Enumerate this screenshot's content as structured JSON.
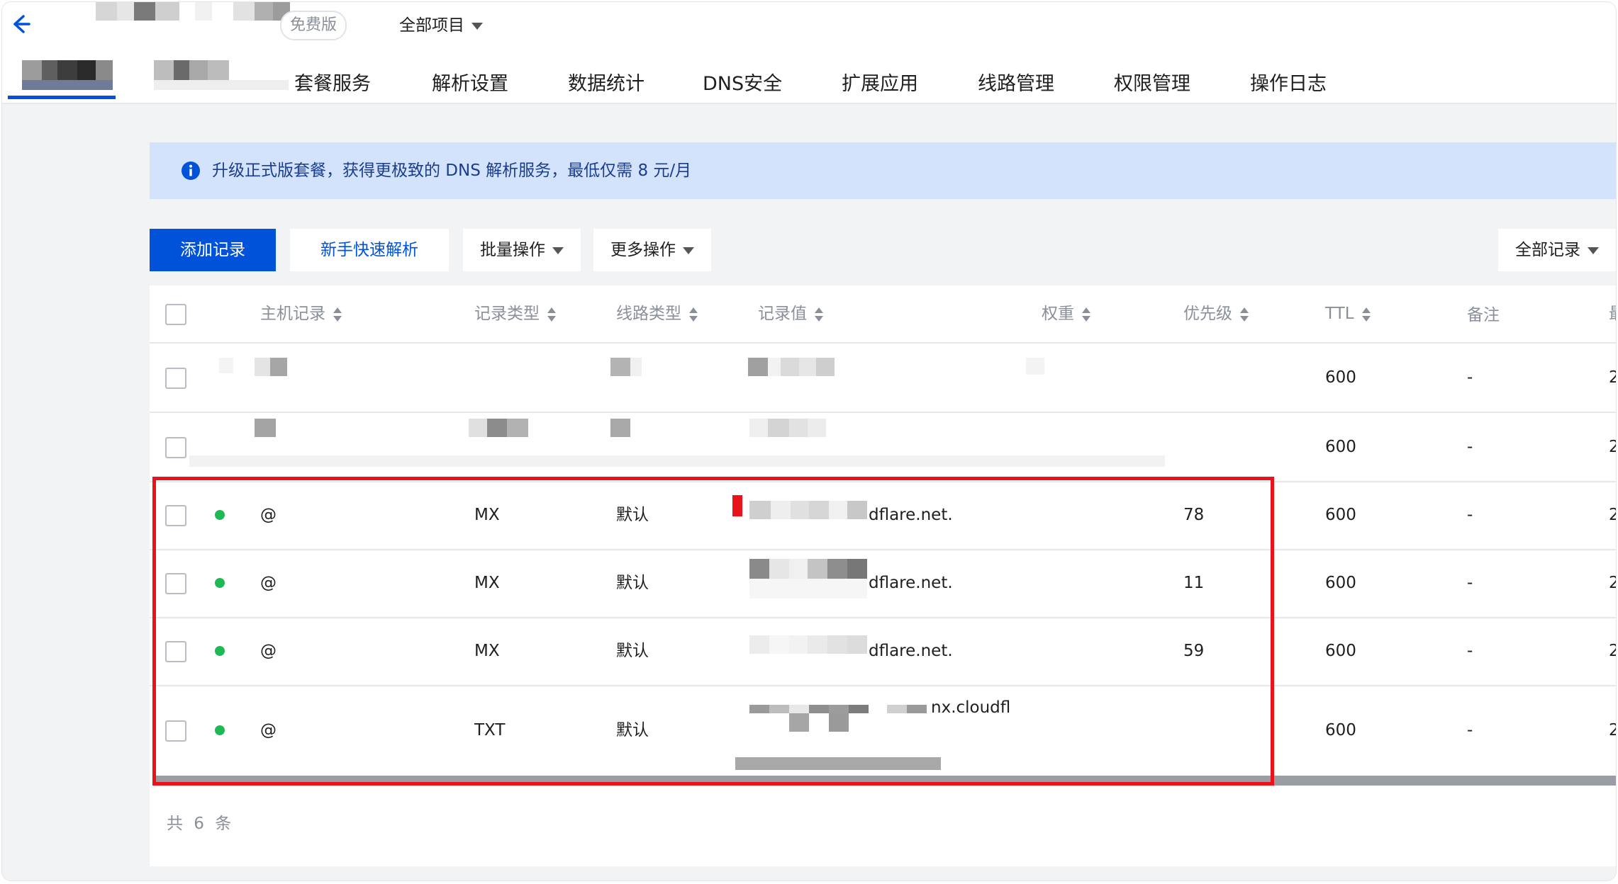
{
  "header": {
    "back_icon": "arrow-left-icon",
    "plan_badge": "免费版",
    "project_select": "全部项目"
  },
  "tabs": [
    {
      "label": "套餐服务"
    },
    {
      "label": "解析设置"
    },
    {
      "label": "数据统计"
    },
    {
      "label": "DNS安全"
    },
    {
      "label": "扩展应用"
    },
    {
      "label": "线路管理"
    },
    {
      "label": "权限管理"
    },
    {
      "label": "操作日志"
    }
  ],
  "notice": {
    "icon": "info-icon",
    "text": "升级正式版套餐，获得更极致的 DNS 解析服务，最低仅需 8 元/月"
  },
  "toolbar": {
    "add_record": "添加记录",
    "quick_parse": "新手快速解析",
    "batch_ops": "批量操作",
    "more_ops": "更多操作",
    "record_filter": "全部记录"
  },
  "table": {
    "headers": {
      "host": "主机记录",
      "type": "记录类型",
      "line": "线路类型",
      "value": "记录值",
      "weight": "权重",
      "priority": "优先级",
      "ttl": "TTL",
      "remark": "备注",
      "last": "最"
    },
    "rows": [
      {
        "host": "",
        "type": "",
        "line": "",
        "value": "",
        "priority": "",
        "ttl": "600",
        "remark": "-",
        "last": "2"
      },
      {
        "host": "",
        "type": "",
        "line": "",
        "value": "",
        "priority": "",
        "ttl": "600",
        "remark": "-",
        "last": "2"
      },
      {
        "host": "@",
        "type": "MX",
        "line": "默认",
        "value": "dflare.net.",
        "priority": "78",
        "ttl": "600",
        "remark": "-",
        "last": "2"
      },
      {
        "host": "@",
        "type": "MX",
        "line": "默认",
        "value": "dflare.net.",
        "priority": "11",
        "ttl": "600",
        "remark": "-",
        "last": "2"
      },
      {
        "host": "@",
        "type": "MX",
        "line": "默认",
        "value": "dflare.net.",
        "priority": "59",
        "ttl": "600",
        "remark": "-",
        "last": "2"
      },
      {
        "host": "@",
        "type": "TXT",
        "line": "默认",
        "value": "nx.cloudfl",
        "priority": "",
        "ttl": "600",
        "remark": "-",
        "last": "2"
      }
    ],
    "total": "共 6 条"
  },
  "colors": {
    "primary": "#0052d9",
    "status_ok": "#1fb855",
    "highlight_border": "#e8131b",
    "notice_bg": "#d4e3fc"
  }
}
